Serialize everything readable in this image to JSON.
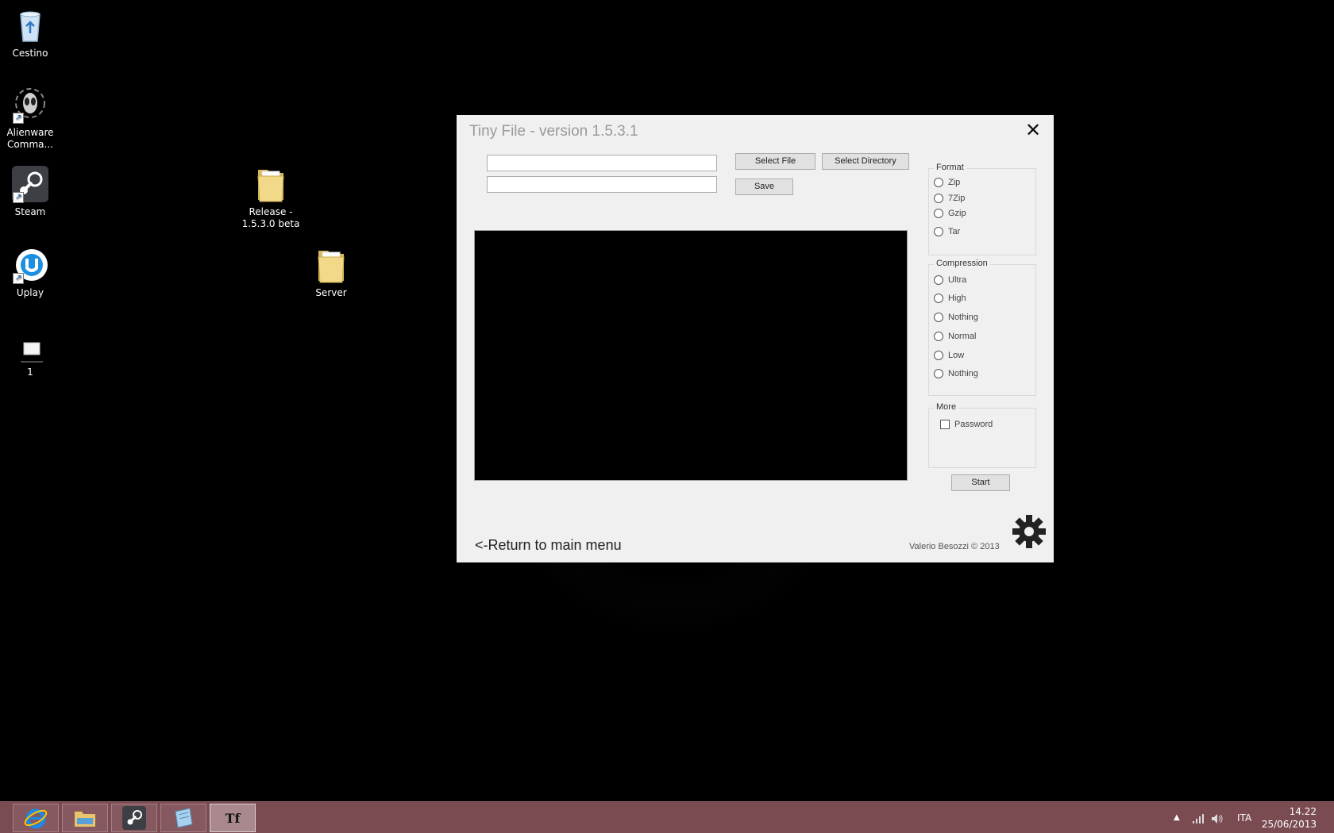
{
  "desktop": {
    "icons": [
      {
        "label": "Cestino"
      },
      {
        "label": "Alienware Comma..."
      },
      {
        "label": "Steam"
      },
      {
        "label": "Uplay"
      },
      {
        "label": "1"
      },
      {
        "label": "Release - 1.5.3.0 beta"
      },
      {
        "label": "Server"
      }
    ]
  },
  "app": {
    "title": "Tiny File - version 1.5.3.1",
    "close_glyph": "✕",
    "input1_value": "",
    "input2_value": "",
    "select_file_label": "Select File",
    "select_directory_label": "Select Directory",
    "save_label": "Save",
    "format": {
      "title": "Format",
      "options": [
        "Zip",
        "7Zip",
        "Gzip",
        "Tar"
      ]
    },
    "compression": {
      "title": "Compression",
      "options": [
        "Ultra",
        "High",
        "Nothing",
        "Normal",
        "Low",
        "Nothing"
      ]
    },
    "more": {
      "title": "More",
      "password_label": "Password"
    },
    "start_label": "Start",
    "return_label": "<-Return to main menu",
    "credit": "Valerio Besozzi © 2013"
  },
  "taskbar": {
    "apps": [
      "internet-explorer-icon",
      "file-explorer-icon",
      "steam-icon",
      "notepad-icon",
      "tiny-file-icon"
    ],
    "active_app_label": "Tf",
    "language": "ITA",
    "time": "14.22",
    "date": "25/06/2013"
  },
  "colors": {
    "taskbar": "#7b4b52",
    "window_bg": "#f0f0f0",
    "preview_bg": "#000000"
  }
}
